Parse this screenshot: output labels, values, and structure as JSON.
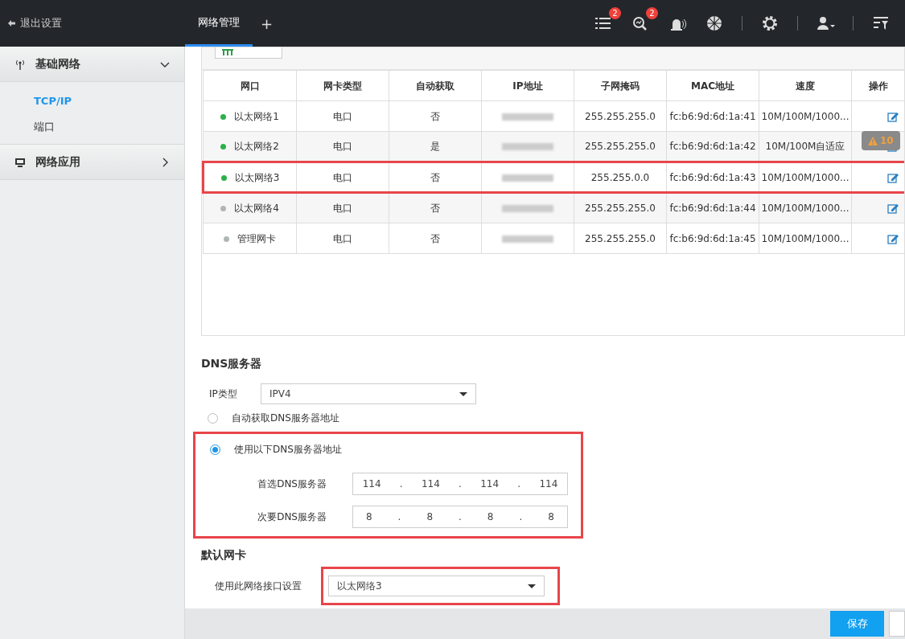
{
  "header": {
    "back_label": "退出设置",
    "tabs": [
      {
        "label": "网络管理",
        "selected": true
      }
    ],
    "add_tab": "+",
    "toolbar": [
      {
        "kind": "list",
        "badge": "2"
      },
      {
        "kind": "search",
        "badge": "2"
      },
      {
        "kind": "alarm"
      },
      {
        "kind": "aperture"
      },
      {
        "kind": "gear"
      },
      {
        "kind": "user"
      },
      {
        "kind": "filter"
      }
    ]
  },
  "sidebar": {
    "groups": [
      {
        "label": "基础网络",
        "kind": "antenna",
        "expanded": true,
        "children": [
          {
            "label": "TCP/IP",
            "selected": true
          },
          {
            "label": "端口",
            "selected": false
          }
        ]
      },
      {
        "label": "网络应用",
        "kind": "monitor",
        "expanded": false
      }
    ]
  },
  "table": {
    "columns": [
      "网口",
      "网卡类型",
      "自动获取",
      "IP地址",
      "子网掩码",
      "MAC地址",
      "速度",
      "操作"
    ],
    "rows": [
      {
        "port": "以太网络1",
        "online": true,
        "type": "电口",
        "auto": "否",
        "mask": "255.255.255.0",
        "mac": "fc:b6:9d:6d:1a:41",
        "speed": "10M/100M/1000...",
        "highlighted": false
      },
      {
        "port": "以太网络2",
        "online": true,
        "type": "电口",
        "auto": "是",
        "mask": "255.255.255.0",
        "mac": "fc:b6:9d:6d:1a:42",
        "speed": "10M/100M自适应",
        "highlighted": false
      },
      {
        "port": "以太网络3",
        "online": true,
        "type": "电口",
        "auto": "否",
        "mask": "255.255.0.0",
        "mac": "fc:b6:9d:6d:1a:43",
        "speed": "10M/100M/1000...",
        "highlighted": true
      },
      {
        "port": "以太网络4",
        "online": false,
        "type": "电口",
        "auto": "否",
        "mask": "255.255.255.0",
        "mac": "fc:b6:9d:6d:1a:44",
        "speed": "10M/100M/1000...",
        "highlighted": false
      },
      {
        "port": "管理网卡",
        "online": false,
        "type": "电口",
        "auto": "否",
        "mask": "255.255.255.0",
        "mac": "fc:b6:9d:6d:1a:45",
        "speed": "10M/100M/1000...",
        "highlighted": false
      }
    ]
  },
  "warning_badge": "10",
  "dns": {
    "title": "DNS服务器",
    "ip_type_label": "IP类型",
    "ip_type": "IPV4",
    "options": [
      {
        "label": "自动获取DNS服务器地址",
        "selected": false
      },
      {
        "label": "使用以下DNS服务器地址",
        "selected": true
      }
    ],
    "highlighted": true,
    "separator": ".",
    "servers": [
      {
        "label": "首选DNS服务器",
        "octets": [
          "114",
          "114",
          "114",
          "114"
        ]
      },
      {
        "label": "次要DNS服务器",
        "octets": [
          "8",
          "8",
          "8",
          "8"
        ]
      }
    ]
  },
  "default_nic": {
    "title": "默认网卡",
    "label": "使用此网络接口设置",
    "value": "以太网络3",
    "highlighted": true
  },
  "footer": {
    "save": "保存"
  }
}
